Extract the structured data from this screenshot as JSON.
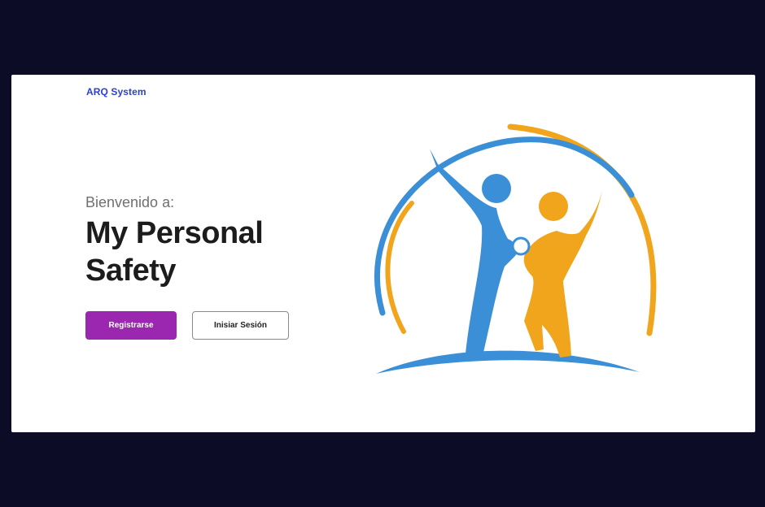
{
  "header": {
    "brand": "ARQ System"
  },
  "hero": {
    "welcome": "Bienvenido a:",
    "title": "My Personal Safety",
    "register_label": "Registrarse",
    "login_label": "Inisiar Sesión"
  },
  "logo": {
    "icon": "family-logo-icon",
    "colors": {
      "blue": "#3a8fd6",
      "orange": "#f0a51c"
    }
  },
  "colors": {
    "page_bg": "#0c0c26",
    "card_bg": "#ffffff",
    "brand": "#2a3fd6",
    "primary_button": "#9b27b0",
    "title_text": "#1c1c1c"
  }
}
